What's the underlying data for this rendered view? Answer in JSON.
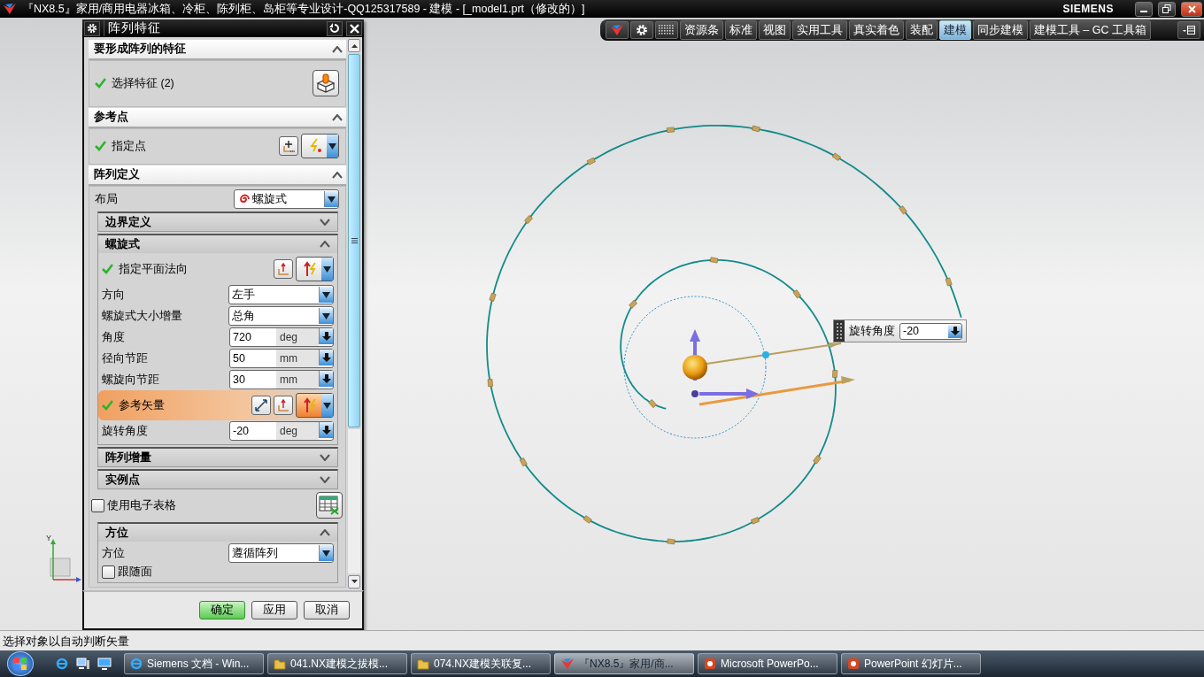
{
  "window": {
    "title": "『NX8.5』家用/商用电器冰箱、冷柜、陈列柜、岛柜等专业设计-QQ125317589 - 建模 - [_model1.prt（修改的）]",
    "brand": "SIEMENS"
  },
  "toolbar": {
    "tabs": [
      {
        "label": "资源条",
        "selected": false
      },
      {
        "label": "标准",
        "selected": false
      },
      {
        "label": "视图",
        "selected": false
      },
      {
        "label": "实用工具",
        "selected": false
      },
      {
        "label": "真实着色",
        "selected": false
      },
      {
        "label": "装配",
        "selected": false
      },
      {
        "label": "建模",
        "selected": true
      },
      {
        "label": "同步建模",
        "selected": false
      },
      {
        "label": "建模工具 – GC 工具箱",
        "selected": false
      }
    ]
  },
  "dialog": {
    "title": "阵列特征",
    "sections": [
      {
        "title": "要形成阵列的特征",
        "expanded": true,
        "rows": [
          {
            "kind": "feature",
            "label": "选择特征 (2)",
            "complete": true,
            "highlighted": false
          }
        ]
      },
      {
        "title": "参考点",
        "expanded": true,
        "rows": [
          {
            "kind": "point",
            "label": "指定点",
            "complete": true,
            "highlighted": false
          }
        ]
      },
      {
        "title": "阵列定义",
        "expanded": true,
        "rows": [
          {
            "kind": "layout",
            "label": "布局",
            "value": "螺旋式"
          },
          {
            "kind": "group",
            "title": "边界定义",
            "expanded": false
          },
          {
            "kind": "group",
            "title": "螺旋式",
            "expanded": true,
            "rows": [
              {
                "kind": "vector",
                "label": "指定平面法向",
                "complete": true,
                "highlighted": false
              },
              {
                "kind": "dropdown",
                "label": "方向",
                "value": "左手"
              },
              {
                "kind": "dropdown",
                "label": "螺旋式大小增量",
                "value": "总角"
              },
              {
                "kind": "number",
                "label": "角度",
                "value": "720",
                "unit": "deg"
              },
              {
                "kind": "number",
                "label": "径向节距",
                "value": "50",
                "unit": "mm"
              },
              {
                "kind": "number",
                "label": "螺旋向节距",
                "value": "30",
                "unit": "mm"
              },
              {
                "kind": "refvector",
                "label": "参考矢量",
                "complete": true,
                "highlighted": true
              },
              {
                "kind": "number",
                "label": "旋转角度",
                "value": "-20",
                "unit": "deg"
              }
            ]
          },
          {
            "kind": "group",
            "title": "阵列增量",
            "expanded": false
          },
          {
            "kind": "group",
            "title": "实例点",
            "expanded": false
          },
          {
            "kind": "spreadsheet",
            "label": "使用电子表格",
            "checked": false
          },
          {
            "kind": "group",
            "title": "方位",
            "expanded": true,
            "rows": [
              {
                "kind": "dropdown",
                "label": "方位",
                "value": "遵循阵列"
              },
              {
                "kind": "checkbox",
                "label": "跟随面",
                "checked": false
              }
            ]
          }
        ]
      }
    ],
    "buttons": [
      {
        "label": "确定",
        "default": true
      },
      {
        "label": "应用",
        "default": false
      },
      {
        "label": "取消",
        "default": false
      }
    ]
  },
  "onscreen_input": {
    "label": "旋转角度",
    "value": "-20"
  },
  "triad": {
    "axis_label": "Y"
  },
  "status_bar": {
    "message": "选择对象以自动判断矢量"
  },
  "taskbar": {
    "tasks": [
      {
        "label": "Siemens 文档 - Win...",
        "kind": "browser",
        "selected": false
      },
      {
        "label": "041.NX建模之拔模...",
        "kind": "folder",
        "selected": false
      },
      {
        "label": "074.NX建模关联复...",
        "kind": "folder",
        "selected": false
      },
      {
        "label": "『NX8.5』家用/商...",
        "kind": "nx",
        "selected": true
      },
      {
        "label": "Microsoft PowerPo...",
        "kind": "ppt",
        "selected": false
      },
      {
        "label": "PowerPoint 幻灯片...",
        "kind": "ppt",
        "selected": false
      }
    ]
  }
}
